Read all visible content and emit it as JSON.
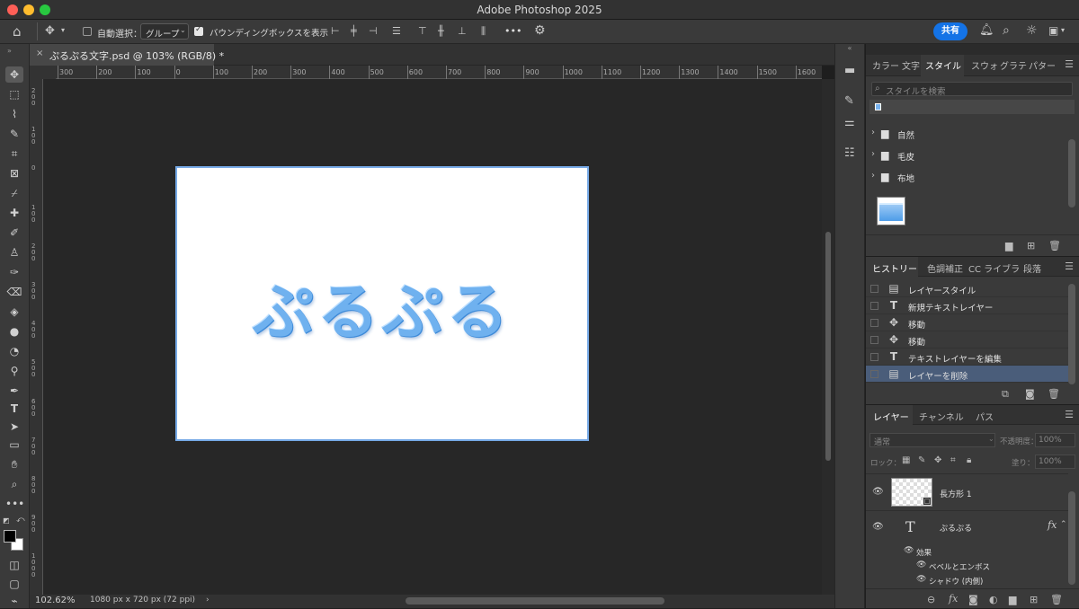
{
  "app": {
    "title": "Adobe Photoshop 2025"
  },
  "options_bar": {
    "auto_select_label": "自動選択：",
    "auto_select_value": "グループ",
    "bounding_box_label": "バウンディングボックスを表示",
    "share_label": "共有",
    "more_label": "•••"
  },
  "document": {
    "tab_title": "ぷるぷる文字.psd @ 103% (RGB/8) *",
    "canvas_text": "ぷるぷる",
    "zoom": "102.62%",
    "size_info": "1080 px x 720 px (72 ppi)"
  },
  "ruler": {
    "h_ticks": [
      "300",
      "200",
      "100",
      "0",
      "100",
      "200",
      "300",
      "400",
      "500",
      "600",
      "700",
      "800",
      "900",
      "1000",
      "1100",
      "1200",
      "1300",
      "1400",
      "1500",
      "1600"
    ],
    "v_ticks": [
      "200",
      "100",
      "0",
      "100",
      "200",
      "300",
      "400",
      "500",
      "600",
      "700",
      "800",
      "900",
      "1000"
    ]
  },
  "styles_panel": {
    "tabs": [
      "カラー",
      "文字",
      "スタイル",
      "スウォ",
      "グラテ",
      "パター"
    ],
    "search_placeholder": "スタイルを検索",
    "folders": [
      "自然",
      "毛皮",
      "布地"
    ]
  },
  "history_panel": {
    "tabs": [
      "ヒストリー",
      "色調補正",
      "CC ライブラ",
      "段落"
    ],
    "items": [
      {
        "label": "レイヤースタイル",
        "icon": "layer-style-icon"
      },
      {
        "label": "新規テキストレイヤー",
        "icon": "type-icon"
      },
      {
        "label": "移動",
        "icon": "move-icon"
      },
      {
        "label": "移動",
        "icon": "move-icon"
      },
      {
        "label": "テキストレイヤーを編集",
        "icon": "type-icon"
      },
      {
        "label": "レイヤーを削除",
        "icon": "layer-style-icon"
      }
    ]
  },
  "layers_panel": {
    "tabs": [
      "レイヤー",
      "チャンネル",
      "パス"
    ],
    "blend_mode": "通常",
    "opacity_label": "不透明度：",
    "opacity_value": "100%",
    "lock_label": "ロック：",
    "fill_label": "塗り：",
    "fill_value": "100%",
    "layers": [
      {
        "name": "長方形 1"
      },
      {
        "name": "ぷるぷる"
      }
    ],
    "effects_label": "効果",
    "effects": [
      "ベベルとエンボス",
      "シャドウ (内側)"
    ]
  },
  "colors": {
    "accent": "#1473e6",
    "selection": "#4a5d7a"
  }
}
